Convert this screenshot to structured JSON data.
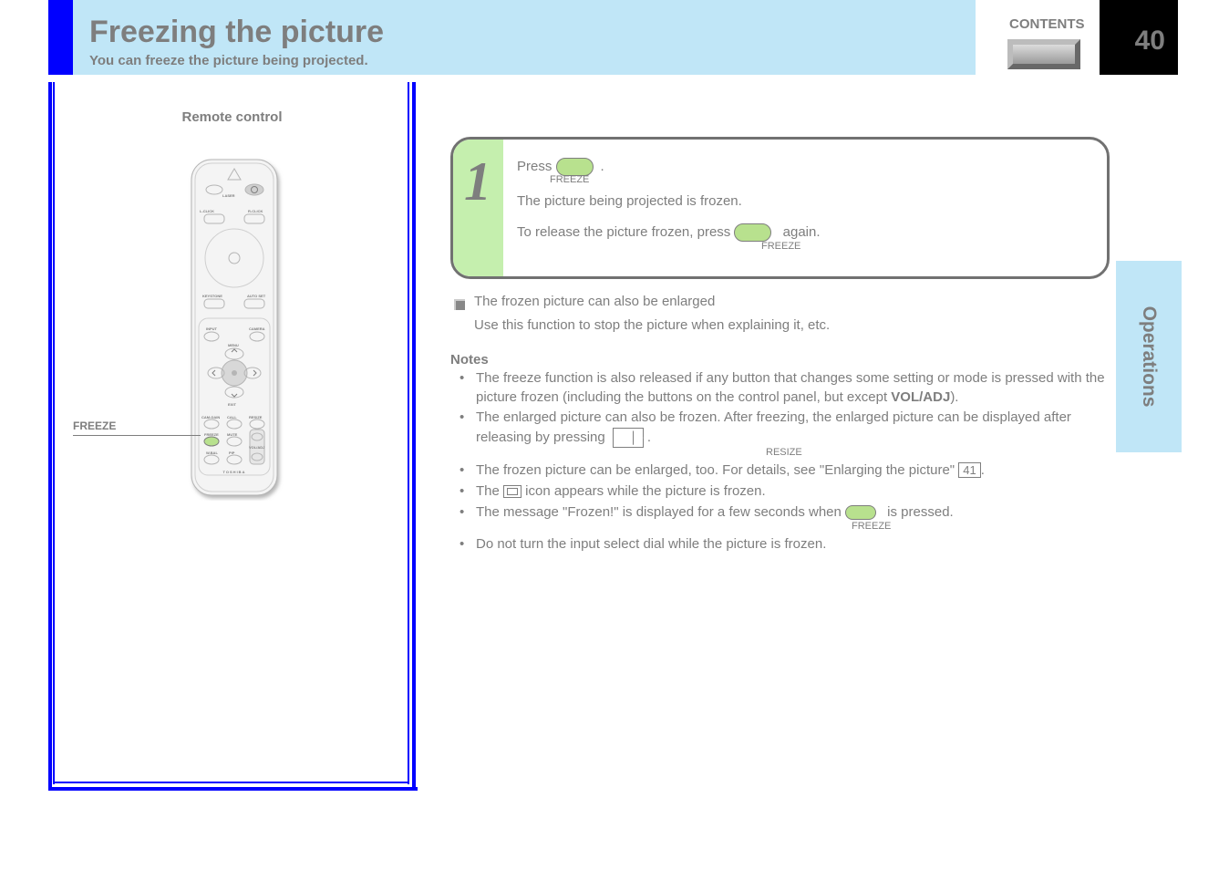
{
  "page_number": "40",
  "header": {
    "title": "Freezing the picture",
    "sub": "You can freeze the picture being projected.",
    "continue_label": "CONTENTS"
  },
  "side_tab": "Operations",
  "remote": {
    "caption": "Remote control",
    "callout": "FREEZE",
    "brand": "TOSHIBA"
  },
  "step": {
    "number": "1",
    "line1_prefix": "Press",
    "line1_suffix": ".",
    "button_label": "FREEZE",
    "line2": "The picture being projected is frozen.",
    "line3_a": "To release the picture frozen, press",
    "line3_b": "again."
  },
  "bullet": {
    "heading": "The frozen picture can also be enlarged",
    "lead": "Use this function to stop the picture when explaining it, etc."
  },
  "notes": {
    "title": "Notes",
    "items": [
      {
        "prefix": "The freeze function is also released if any button that changes some setting or mode is pressed with the picture frozen (including the buttons on the control panel, but except",
        "button": "VOL/ADJ",
        "suffix": ")."
      },
      {
        "prefix": "The enlarged picture can also be frozen. After freezing, the enlarged picture can be displayed after releasing by pressing",
        "button": "",
        "suffix": "."
      },
      {
        "prefix": "The frozen picture can be enlarged, too.",
        "button": "",
        "suffix": "For details, see \"Enlarging the picture\"."
      },
      {
        "prefix": "The",
        "button": "",
        "suffix": "icon appears while the picture is frozen."
      },
      {
        "prefix": "The message \"Frozen!\" is displayed for a few seconds when",
        "button": "",
        "suffix": "is pressed.",
        "button_after": "FREEZE"
      },
      {
        "prefix": "Do not turn the input select dial while the picture is frozen.",
        "button": "",
        "suffix": ""
      }
    ],
    "page_ref": "41"
  }
}
